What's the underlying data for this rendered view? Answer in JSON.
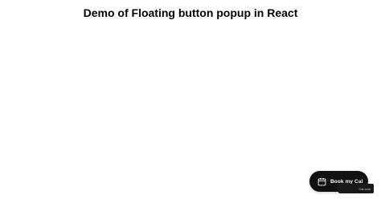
{
  "page": {
    "title": "Demo of Floating button popup in React"
  },
  "floating_button": {
    "label": "Book my Cal",
    "icon": "calendar-icon"
  },
  "badge": {
    "text": "Cal.com"
  },
  "colors": {
    "background": "#ffffff",
    "button_bg": "#111111",
    "button_text": "#ffffff"
  }
}
